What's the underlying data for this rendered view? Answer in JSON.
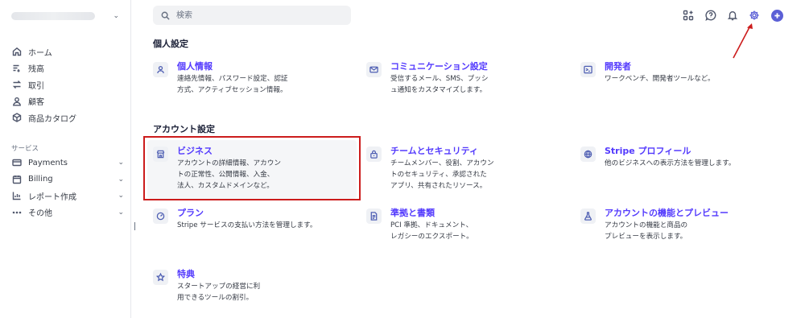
{
  "search": {
    "placeholder": "検索"
  },
  "sidebar": {
    "main": [
      {
        "label": "ホーム",
        "icon": "home-icon"
      },
      {
        "label": "残高",
        "icon": "balance-icon"
      },
      {
        "label": "取引",
        "icon": "transactions-icon"
      },
      {
        "label": "顧客",
        "icon": "customer-icon"
      },
      {
        "label": "商品カタログ",
        "icon": "product-catalog-icon"
      }
    ],
    "section_label": "サービス",
    "services": [
      {
        "label": "Payments",
        "icon": "card-icon"
      },
      {
        "label": "Billing",
        "icon": "billing-icon"
      },
      {
        "label": "レポート作成",
        "icon": "report-icon"
      },
      {
        "label": "その他",
        "icon": "more-icon"
      }
    ]
  },
  "personal": {
    "heading": "個人設定",
    "cards": [
      {
        "title": "個人情報",
        "desc": [
          "連絡先情報、パスワード設定、認証",
          "方式、アクティブセッション情報。"
        ],
        "icon": "person-icon"
      },
      {
        "title": "コミュニケーション設定",
        "desc": [
          "受信するメール、SMS、プッシ",
          "ュ通知をカスタマイズします。"
        ],
        "icon": "mail-icon"
      },
      {
        "title": "開発者",
        "desc": [
          "ワークベンチ、開発者ツールなど。"
        ],
        "icon": "terminal-icon"
      }
    ]
  },
  "account": {
    "heading": "アカウント設定",
    "cards": [
      {
        "title": "ビジネス",
        "desc": [
          "アカウントの詳細情報、アカウン",
          "トの正常性、公開情報、入金、",
          "法人、カスタムドメインなど。"
        ],
        "icon": "store-icon"
      },
      {
        "title": "チームとセキュリティ",
        "desc": [
          "チームメンバー、役割、アカウン",
          "トのセキュリティ、承認された",
          "アプリ、共有されたリソース。"
        ],
        "icon": "lock-icon"
      },
      {
        "title": "Stripe プロフィール",
        "desc": [
          "他のビジネスへの表示方法を管理します。"
        ],
        "icon": "globe-icon"
      },
      {
        "title": "プラン",
        "desc": [
          "Stripe サービスの支払い方法を管理します。"
        ],
        "icon": "gauge-icon"
      },
      {
        "title": "準拠と書類",
        "desc": [
          "PCI 準拠、ドキュメント、",
          "レガシーのエクスポート。"
        ],
        "icon": "document-icon"
      },
      {
        "title": "アカウントの機能とプレビュー",
        "desc": [
          "アカウントの機能と商品の",
          "プレビューを表示します。"
        ],
        "icon": "flask-icon"
      },
      {
        "title": "特典",
        "desc": [
          "スタートアップの経営に利",
          "用できるツールの割引。"
        ],
        "icon": "star-icon"
      }
    ]
  },
  "colors": {
    "accent": "#533afd",
    "highlight_border": "#cc1c1c",
    "annotation_arrow": "#cc1c1c"
  }
}
